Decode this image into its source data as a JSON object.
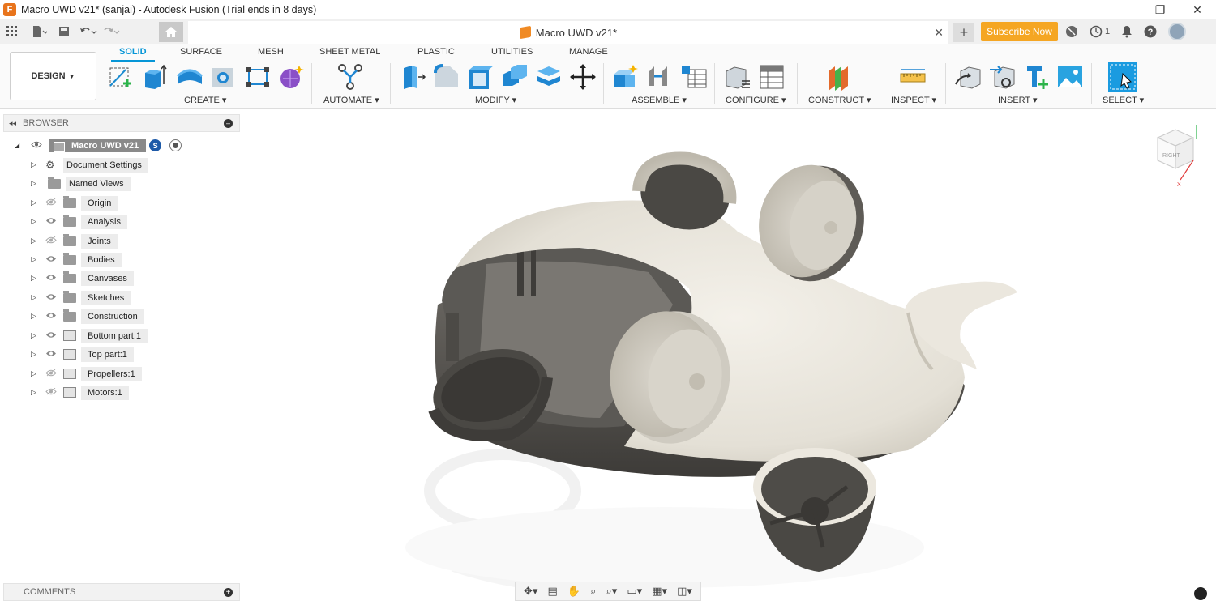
{
  "window": {
    "title": "Macro UWD v21* (sanjai) - Autodesk Fusion (Trial ends in 8 days)",
    "app_logo": "F",
    "controls": {
      "minimize": "—",
      "maximize": "❐",
      "close": "✕"
    }
  },
  "tabbar": {
    "doc_tab": "Macro UWD v21*",
    "subscribe": "Subscribe Now",
    "notifications_count": "1"
  },
  "ribbon": {
    "workspace": "DESIGN",
    "tabs": [
      "SOLID",
      "SURFACE",
      "MESH",
      "SHEET METAL",
      "PLASTIC",
      "UTILITIES",
      "MANAGE"
    ],
    "groups": [
      "CREATE",
      "AUTOMATE",
      "MODIFY",
      "ASSEMBLE",
      "CONFIGURE",
      "CONSTRUCT",
      "INSPECT",
      "INSERT",
      "SELECT"
    ]
  },
  "browser": {
    "title": "BROWSER",
    "root": "Macro UWD v21",
    "root_badge": "S",
    "items": [
      {
        "label": "Document Settings"
      },
      {
        "label": "Named Views"
      },
      {
        "label": "Origin"
      },
      {
        "label": "Analysis"
      },
      {
        "label": "Joints"
      },
      {
        "label": "Bodies"
      },
      {
        "label": "Canvases"
      },
      {
        "label": "Sketches"
      },
      {
        "label": "Construction"
      },
      {
        "label": "Bottom part:1"
      },
      {
        "label": "Top part:1"
      },
      {
        "label": "Propellers:1"
      },
      {
        "label": "Motors:1"
      }
    ]
  },
  "comments": {
    "title": "COMMENTS"
  },
  "viewcube": {
    "face": "RIGHT"
  },
  "colors": {
    "accent": "#0696d7",
    "subscribe": "#f5a623",
    "body_light": "#ece8df",
    "body_dark": "#4a4844"
  }
}
